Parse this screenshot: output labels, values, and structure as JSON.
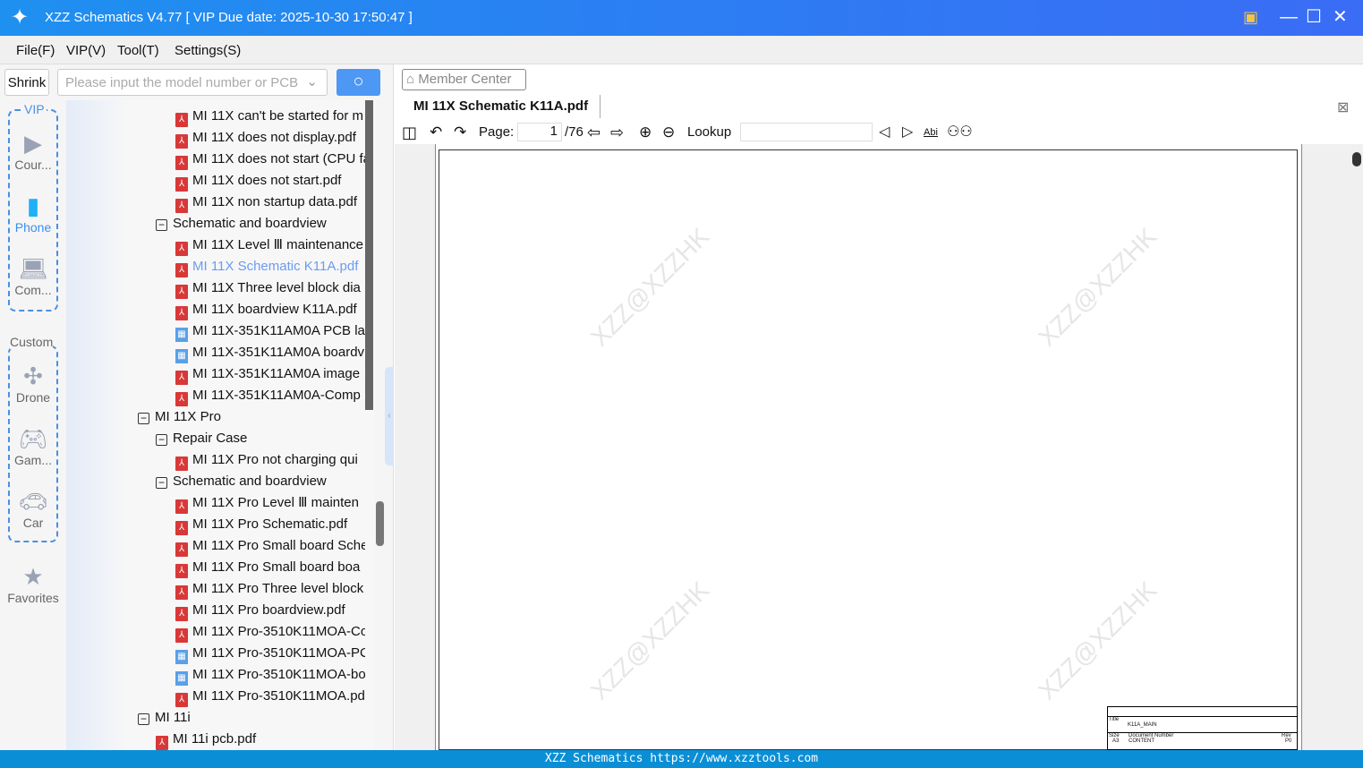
{
  "window": {
    "title": "XZZ Schematics V4.77 [ VIP Due date: 2025-10-30 17:50:47 ]"
  },
  "menu": [
    "File(F)",
    "VIP(V)",
    "Tool(T)",
    "Settings(S)"
  ],
  "search": {
    "shrink_label": "Shrink",
    "placeholder": "Please input the model number or PCB"
  },
  "nav": {
    "vip_label": "VIP",
    "custom_label": "Custom",
    "items": [
      {
        "label": "Cour...",
        "icon": "play-icon"
      },
      {
        "label": "Phone",
        "icon": "phone-icon",
        "active": true
      },
      {
        "label": "Com...",
        "icon": "laptop-icon"
      },
      {
        "label": "Drone",
        "icon": "drone-icon"
      },
      {
        "label": "Gam...",
        "icon": "gamepad-icon"
      },
      {
        "label": "Car",
        "icon": "car-icon"
      },
      {
        "label": "Favorites",
        "icon": "star-icon"
      }
    ]
  },
  "tree": [
    {
      "level": 2,
      "type": "pdf",
      "label": "MI 11X can't be started for m"
    },
    {
      "level": 2,
      "type": "pdf",
      "label": "MI 11X does not display.pdf"
    },
    {
      "level": 2,
      "type": "pdf",
      "label": "MI 11X does not start (CPU fa"
    },
    {
      "level": 2,
      "type": "pdf",
      "label": "MI 11X does not start.pdf"
    },
    {
      "level": 2,
      "type": "pdf",
      "label": "MI 11X non startup data.pdf"
    },
    {
      "level": 1,
      "type": "folder",
      "label": "Schematic and boardview"
    },
    {
      "level": 2,
      "type": "pdf",
      "label": "MI 11X Level Ⅲ maintenance"
    },
    {
      "level": 2,
      "type": "pdf",
      "label": "MI 11X Schematic K11A.pdf",
      "selected": true
    },
    {
      "level": 2,
      "type": "pdf",
      "label": "MI 11X Three level block dia"
    },
    {
      "level": 2,
      "type": "pdf",
      "label": "MI 11X boardview K11A.pdf"
    },
    {
      "level": 2,
      "type": "pcb",
      "label": "MI 11X-351K11AM0A PCB la"
    },
    {
      "level": 2,
      "type": "pcb",
      "label": "MI 11X-351K11AM0A boardv"
    },
    {
      "level": 2,
      "type": "pdf",
      "label": "MI 11X-351K11AM0A image"
    },
    {
      "level": 2,
      "type": "pdf",
      "label": "MI 11X-351K11AM0A-Comp"
    },
    {
      "level": 0,
      "type": "folder",
      "label": "MI 11X Pro"
    },
    {
      "level": 1,
      "type": "folder",
      "label": "Repair Case"
    },
    {
      "level": 2,
      "type": "pdf",
      "label": "MI 11X Pro not charging qui"
    },
    {
      "level": 1,
      "type": "folder",
      "label": "Schematic and boardview"
    },
    {
      "level": 2,
      "type": "pdf",
      "label": "MI 11X Pro Level Ⅲ mainten"
    },
    {
      "level": 2,
      "type": "pdf",
      "label": "MI 11X Pro Schematic.pdf"
    },
    {
      "level": 2,
      "type": "pdf",
      "label": "MI 11X Pro Small board Sche"
    },
    {
      "level": 2,
      "type": "pdf",
      "label": "MI 11X Pro Small board boa"
    },
    {
      "level": 2,
      "type": "pdf",
      "label": "MI 11X Pro Three level block"
    },
    {
      "level": 2,
      "type": "pdf",
      "label": "MI 11X Pro boardview.pdf"
    },
    {
      "level": 2,
      "type": "pdf",
      "label": "MI 11X Pro-3510K11MOA-Co"
    },
    {
      "level": 2,
      "type": "pcb",
      "label": "MI 11X Pro-3510K11MOA-PC"
    },
    {
      "level": 2,
      "type": "pcb",
      "label": "MI 11X Pro-3510K11MOA-bo"
    },
    {
      "level": 2,
      "type": "pdf",
      "label": "MI 11X Pro-3510K11MOA.pd"
    },
    {
      "level": 0,
      "type": "folder",
      "label": "MI 11i"
    },
    {
      "level": 1,
      "type": "pdf",
      "label": "MI 11i pcb.pdf"
    }
  ],
  "viewer": {
    "member_center": "Member Center",
    "tab": "MI 11X Schematic K11A.pdf",
    "page_label": "Page:",
    "page": "1",
    "total": "/76",
    "lookup_label": "Lookup",
    "lookup_value": "",
    "find_icon_text": "Abi",
    "watermark": "XZZ@XZZHK",
    "titleblock": {
      "title_label": "Title",
      "title": "K11A_MAIN",
      "size_label": "Size",
      "size": "A3",
      "docnum_label": "Document Number",
      "docnum": "CONTENT",
      "rev_label": "Rev",
      "rev": "P0"
    }
  },
  "status": "XZZ Schematics https://www.xzztools.com",
  "colors": {
    "titlebar": "#1e90f0",
    "status": "#0a8fd6",
    "accent": "#4d97f5",
    "pdf": "#d93838"
  }
}
